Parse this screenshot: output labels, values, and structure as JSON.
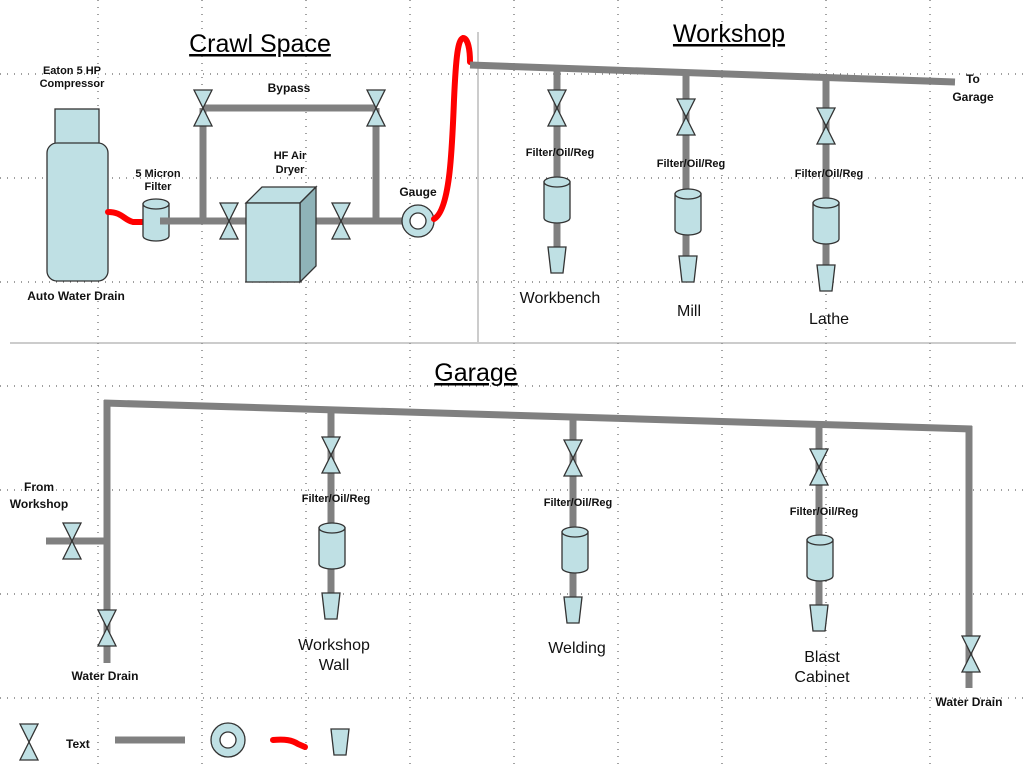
{
  "sections": {
    "crawl_space": {
      "title": "Crawl Space",
      "compressor_label_line1": "Eaton 5 HP",
      "compressor_label_line2": "Compressor",
      "auto_water_drain": "Auto Water Drain",
      "filter_label_line1": "5 Micron",
      "filter_label_line2": "Filter",
      "bypass_label": "Bypass",
      "dryer_label_line1": "HF Air",
      "dryer_label_line2": "Dryer",
      "gauge_label": "Gauge"
    },
    "workshop": {
      "title": "Workshop",
      "to_garage_line1": "To",
      "to_garage_line2": "Garage",
      "drops": [
        {
          "fr_label": "Filter/Oil/Reg",
          "station": "Workbench"
        },
        {
          "fr_label": "Filter/Oil/Reg",
          "station": "Mill"
        },
        {
          "fr_label": "Filter/Oil/Reg",
          "station": "Lathe"
        }
      ]
    },
    "garage": {
      "title": "Garage",
      "from_workshop_line1": "From",
      "from_workshop_line2": "Workshop",
      "water_drain_left": "Water Drain",
      "water_drain_right": "Water Drain",
      "drops": [
        {
          "fr_label": "Filter/Oil/Reg",
          "station_line1": "Workshop",
          "station_line2": "Wall"
        },
        {
          "fr_label": "Filter/Oil/Reg",
          "station_line1": "Welding",
          "station_line2": ""
        },
        {
          "fr_label": "Filter/Oil/Reg",
          "station_line1": "Blast",
          "station_line2": "Cabinet"
        }
      ]
    }
  },
  "legend": {
    "valve": "valve-icon",
    "text_sample": "Text",
    "pipe": "pipe-segment",
    "gauge": "gauge-icon",
    "hose": "hose-segment",
    "outlet": "outlet-icon"
  },
  "colors": {
    "pipe": "#808080",
    "hose": "#ff0000",
    "component_fill": "#bfe0e4",
    "component_shade": "#8fb3b8"
  }
}
